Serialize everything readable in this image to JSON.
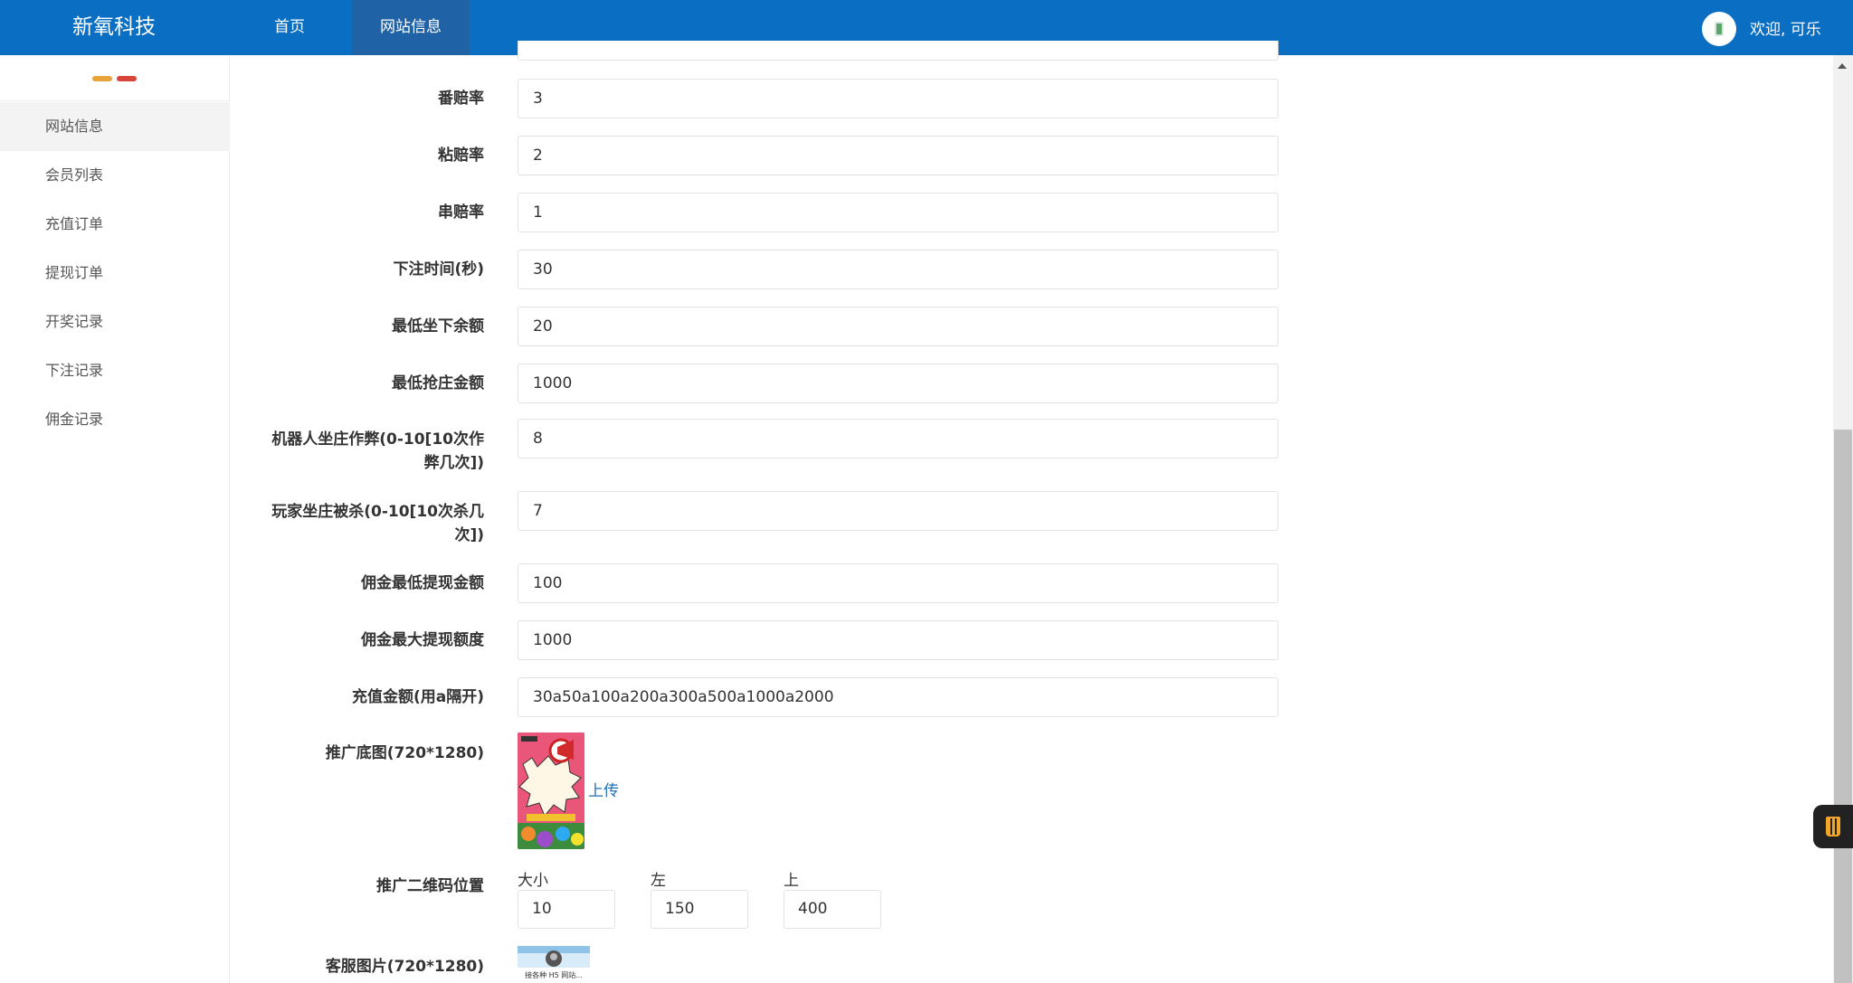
{
  "header": {
    "brand": "新氧科技",
    "nav": [
      "首页",
      "网站信息"
    ],
    "welcome": "欢迎, 可乐"
  },
  "sidebar": {
    "items": [
      "网站信息",
      "会员列表",
      "充值订单",
      "提现订单",
      "开奖记录",
      "下注记录",
      "佣金记录"
    ],
    "active_index": 0
  },
  "form": {
    "rows": [
      {
        "label": "番赔率",
        "value": "3"
      },
      {
        "label": "粘赔率",
        "value": "2"
      },
      {
        "label": "串赔率",
        "value": "1"
      },
      {
        "label": "下注时间(秒)",
        "value": "30"
      },
      {
        "label": "最低坐下余额",
        "value": "20"
      },
      {
        "label": "最低抢庄金额",
        "value": "1000"
      },
      {
        "label_lines": [
          "机器人坐庄作弊(0-10[10次作",
          "弊几次])"
        ],
        "value": "8"
      },
      {
        "label_lines": [
          "玩家坐庄被杀(0-10[10次杀几",
          "次])"
        ],
        "value": "7"
      },
      {
        "label": "佣金最低提现金额",
        "value": "100"
      },
      {
        "label": "佣金最大提现额度",
        "value": "1000"
      },
      {
        "label": "充值金额(用a隔开)",
        "value": "30a50a100a200a300a500a1000a2000"
      }
    ],
    "promo_image": {
      "label": "推广底图(720*1280)",
      "upload": "上传"
    },
    "qr_position": {
      "label": "推广二维码位置",
      "size_label": "大小",
      "size": "10",
      "left_label": "左",
      "left": "150",
      "top_label": "上",
      "top": "400"
    },
    "service_image": {
      "label": "客服图片(720*1280)",
      "caption": "接各种 H5 网站..."
    }
  },
  "colors": {
    "header_bg": "#0a6fc2",
    "nav_active_bg": "#1f63a6",
    "link": "#1f6fb5"
  }
}
